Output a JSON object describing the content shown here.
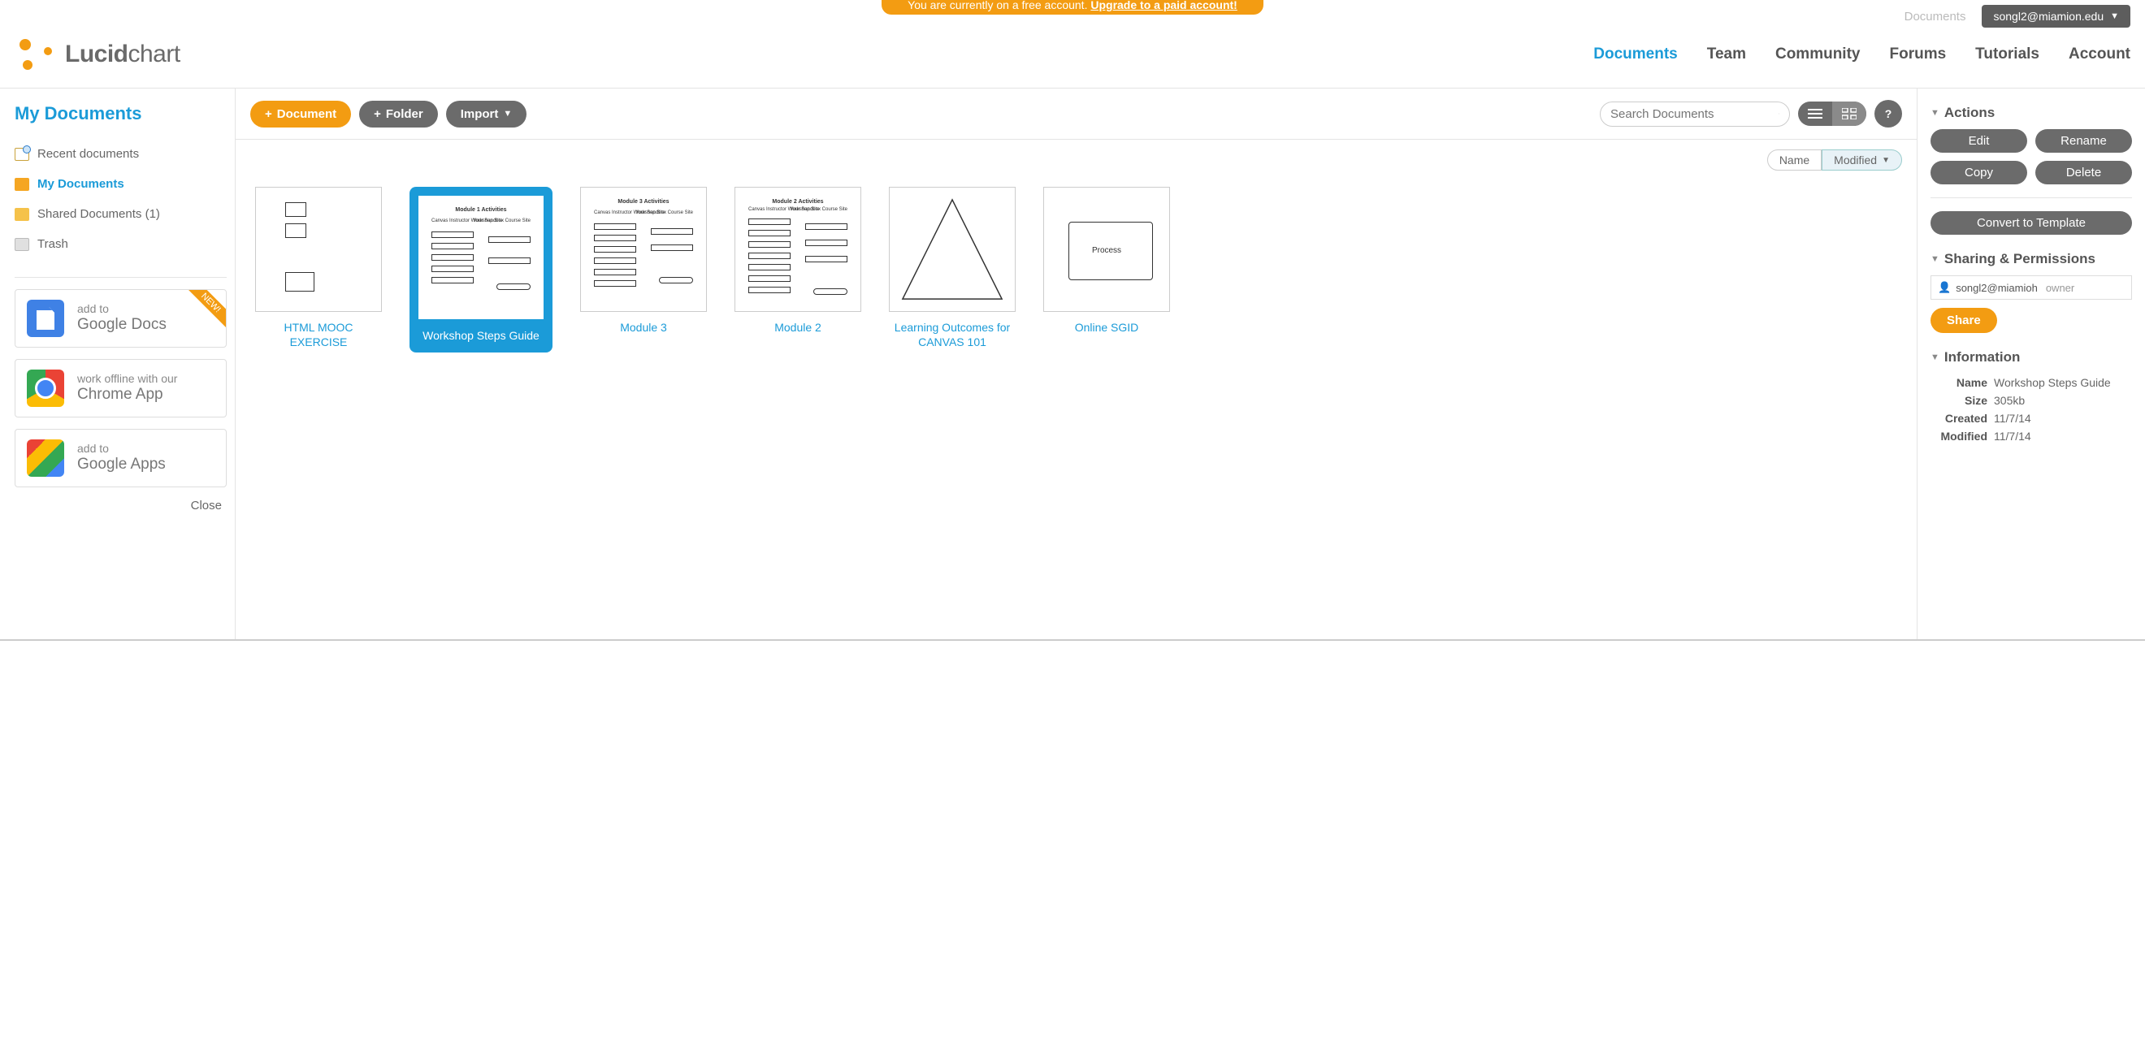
{
  "banner": {
    "prefix": "You are currently on a free account.",
    "link": "Upgrade to a paid account!"
  },
  "breadcrumb": "Documents",
  "user": "songl2@miamion.edu",
  "logo": {
    "bold": "Lucid",
    "light": "chart"
  },
  "nav": [
    {
      "label": "Documents",
      "active": true
    },
    {
      "label": "Team"
    },
    {
      "label": "Community"
    },
    {
      "label": "Forums"
    },
    {
      "label": "Tutorials"
    },
    {
      "label": "Account"
    }
  ],
  "left": {
    "title": "My Documents",
    "items": [
      {
        "label": "Recent documents",
        "icon": "clock"
      },
      {
        "label": "My Documents",
        "icon": "folder-active",
        "active": true
      },
      {
        "label": "Shared Documents (1)",
        "icon": "folder"
      },
      {
        "label": "Trash",
        "icon": "trash"
      }
    ],
    "promos": [
      {
        "line1": "add to",
        "line2": "Google Docs",
        "icon": "gdocs",
        "new": true
      },
      {
        "line1": "work offline with our",
        "line2": "Chrome App",
        "icon": "chrome"
      },
      {
        "line1": "add to",
        "line2": "Google Apps",
        "icon": "gapps"
      }
    ],
    "close": "Close"
  },
  "toolbar": {
    "document": "Document",
    "folder": "Folder",
    "import": "Import",
    "search_placeholder": "Search Documents",
    "help": "?"
  },
  "sort": {
    "name": "Name",
    "modified": "Modified"
  },
  "docs": [
    {
      "label": "HTML MOOC EXERCISE",
      "thumb": "boxes"
    },
    {
      "label": "Workshop Steps Guide",
      "thumb": "flow",
      "selected": true
    },
    {
      "label": "Module 3",
      "thumb": "flow"
    },
    {
      "label": "Module 2",
      "thumb": "flow"
    },
    {
      "label": "Learning Outcomes for CANVAS 101",
      "thumb": "triangle"
    },
    {
      "label": "Online SGID",
      "thumb": "process"
    }
  ],
  "right": {
    "actions_title": "Actions",
    "buttons": {
      "edit": "Edit",
      "rename": "Rename",
      "copy": "Copy",
      "delete": "Delete",
      "convert": "Convert to Template"
    },
    "sharing_title": "Sharing & Permissions",
    "share_user": "songl2@miamioh",
    "share_role": "owner",
    "share_btn": "Share",
    "info_title": "Information",
    "info": {
      "name_k": "Name",
      "name_v": "Workshop Steps Guide",
      "size_k": "Size",
      "size_v": "305kb",
      "created_k": "Created",
      "created_v": "11/7/14",
      "modified_k": "Modified",
      "modified_v": "11/7/14"
    }
  }
}
